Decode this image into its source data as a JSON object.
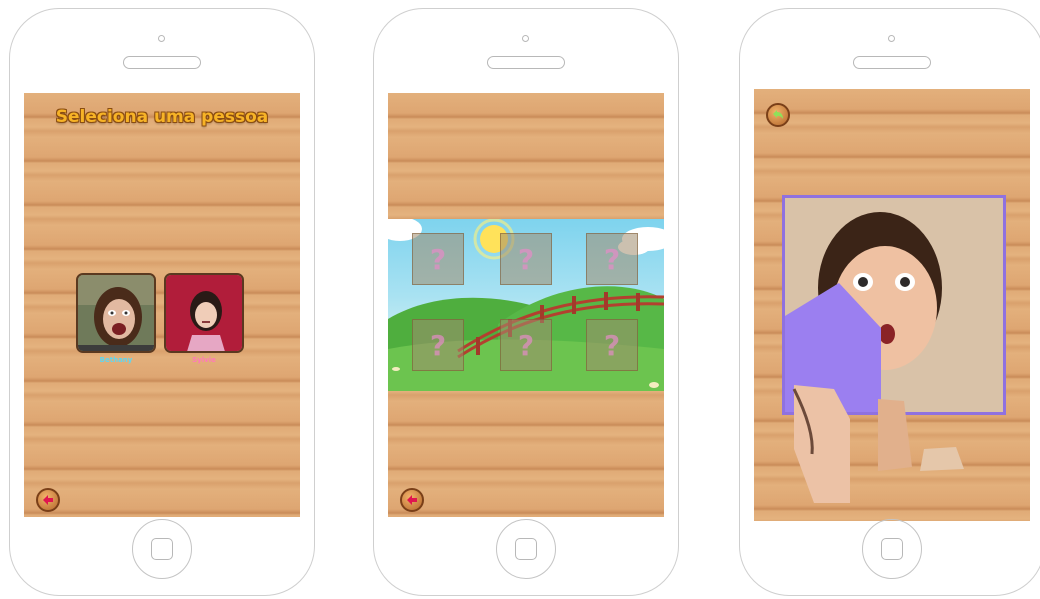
{
  "screen1": {
    "title": "Seleciona uma pessoa",
    "people": [
      {
        "name": "Bethany",
        "name_color": "#5fd6f0"
      },
      {
        "name": "Sylvie",
        "name_color": "#ff79b8"
      }
    ],
    "back_icon": "back-arrow-icon"
  },
  "screen2": {
    "tiles_mark": "?",
    "back_icon": "back-arrow-icon"
  },
  "screen3": {
    "back_icon": "undo-arrow-icon",
    "accent_color": "#9b7ff0"
  }
}
